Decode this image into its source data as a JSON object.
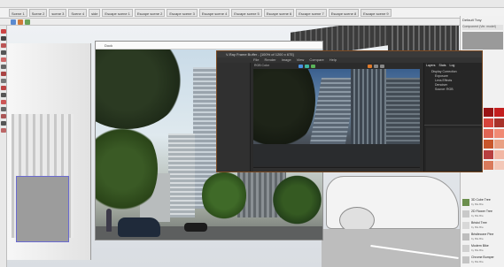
{
  "host": {
    "menu_items": [
      "File",
      "Edit",
      "View",
      "Camera",
      "Draw",
      "Tools",
      "Window",
      "Extensions",
      "Help"
    ],
    "scene_tabs": [
      "Scene 1",
      "Scene 2",
      "scene 3",
      "Scene 4",
      "side",
      "Escape scene 1",
      "Escape scene 2",
      "Escape scene 3",
      "Escape scene 4",
      "Escape scene 5",
      "Escape scene 6",
      "Escape scene 7",
      "Escape scene 8",
      "Escape scene 9",
      "Escape scene 10",
      "Escape scene 11"
    ]
  },
  "tray": {
    "title": "Default Tray",
    "panel_label": "Component (Ver. model)",
    "colors_label": "Colors",
    "swatch_colors": [
      "#9a1414",
      "#c41e1e",
      "#d8443a",
      "#a8322a",
      "#e06552",
      "#f08a74",
      "#c8572b",
      "#e9a184",
      "#b83f3f",
      "#f2b7a4",
      "#d97a5a",
      "#f3c8b8"
    ],
    "components": [
      {
        "name": "3D Cube Tree",
        "by": "by Bla Bla"
      },
      {
        "name": "2D Flower Tree",
        "by": "by Bla Bla"
      },
      {
        "name": "Bristol Tree",
        "by": "by Bla Bla"
      },
      {
        "name": "Bristlecone Pine",
        "by": "by Bla Bla"
      },
      {
        "name": "Modern Bike",
        "by": "by Bla Bla"
      },
      {
        "name": "Chrome Bumper",
        "by": "by Bla Bla"
      },
      {
        "name": "Stacked Green",
        "by": "by Bla Bla"
      }
    ]
  },
  "render_window": {
    "title": "Dock"
  },
  "frame_buffer": {
    "title": "V-Ray Frame Buffer - [100% of 1200 x 675]",
    "menu": [
      "File",
      "Render",
      "Image",
      "View",
      "Compare",
      "Help"
    ],
    "channel": "RGB Color",
    "layers_label": "Layers",
    "stats_label": "Stats",
    "log_label": "Log",
    "tree": [
      "Display Correction",
      "Exposure",
      "Lens Effects",
      "Denoiser",
      "Source: RGB"
    ],
    "accent": "#e07a2a"
  }
}
